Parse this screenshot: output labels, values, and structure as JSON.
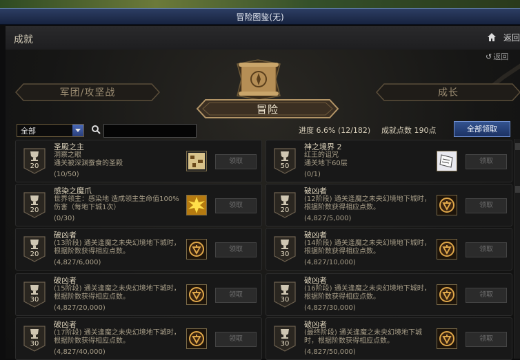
{
  "window": {
    "title": "冒险图鉴(无)"
  },
  "header": {
    "title": "成就",
    "back_label": "返回"
  },
  "sub_back_label": "返回",
  "tabs": {
    "left": "军团/攻坚战",
    "center": "冒险",
    "right": "成长"
  },
  "filter": {
    "selected": "全部",
    "search_placeholder": ""
  },
  "stats": {
    "progress": "进度  6.6% (12/182)",
    "points": "成就点数 190点"
  },
  "claim_all_label": "全部领取",
  "cards": [
    {
      "points": "20",
      "name": "圣殿之主",
      "desc": "洞察之眼\n通关被深渊蚕食的圣殿",
      "progress": "(10/50)",
      "icon": "map-icon",
      "button": "领取"
    },
    {
      "points": "50",
      "name": "神之境界 2",
      "desc": "红王的诅咒\n通关地下60层",
      "progress": "(0/1)",
      "icon": "scroll-icon",
      "button": "领取"
    },
    {
      "points": "20",
      "name": "感染之魔爪",
      "desc": "世界领主：感染地        造成领主生命值100%伤害（每地下城1次）",
      "progress": "(0/30)",
      "icon": "burst-icon",
      "button": "领取"
    },
    {
      "points": "20",
      "name": "破凶者",
      "desc": "(12阶段) 通关逢魔之未央幻境地下城时，根据阶数获得相应点数。",
      "progress": "(4,827/5,000)",
      "icon": "emblem-icon",
      "button": "领取"
    },
    {
      "points": "20",
      "name": "破凶者",
      "desc": "(13阶段) 通关逢魔之未央幻境地下城时，根据阶数获得相应点数。",
      "progress": "(4,827/6,000)",
      "icon": "emblem-icon",
      "button": "领取"
    },
    {
      "points": "30",
      "name": "破凶者",
      "desc": "(14阶段) 通关逢魔之未央幻境地下城时，根据阶数获得相应点数。",
      "progress": "(4,827/10,000)",
      "icon": "emblem-icon",
      "button": "领取"
    },
    {
      "points": "30",
      "name": "破凶者",
      "desc": "(15阶段) 通关逢魔之未央幻境地下城时，根据阶数获得相应点数。",
      "progress": "(4,827/20,000)",
      "icon": "emblem-icon",
      "button": "领取"
    },
    {
      "points": "30",
      "name": "破凶者",
      "desc": "(16阶段) 通关逢魔之未央幻境地下城时，根据阶数获得相应点数。",
      "progress": "(4,827/30,000)",
      "icon": "emblem-icon",
      "button": "领取"
    },
    {
      "points": "30",
      "name": "破凶者",
      "desc": "(17阶段) 通关逢魔之未央幻境地下城时，根据阶数获得相应点数。",
      "progress": "(4,827/40,000)",
      "icon": "emblem-icon",
      "button": "领取"
    },
    {
      "points": "30",
      "name": "破凶者",
      "desc": "(最终阶段) 通关逢魔之未央幻境地下城时，根据阶数获得相应点数。",
      "progress": "(4,827/50,000)",
      "icon": "emblem-icon",
      "button": "领取"
    }
  ]
}
